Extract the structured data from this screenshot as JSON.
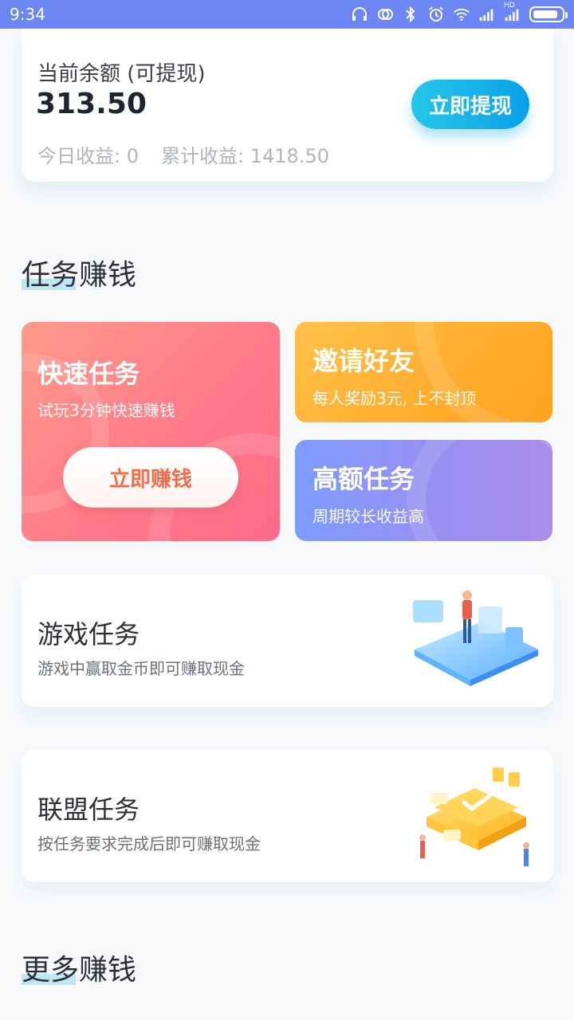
{
  "status_bar": {
    "time": "9:34",
    "hd_label": "HD"
  },
  "balance": {
    "label": "当前余额 (可提现)",
    "value": "313.50",
    "withdraw_button": "立即提现",
    "today_label": "今日收益:",
    "today_value": "0",
    "total_label": "累计收益:",
    "total_value": "1418.50"
  },
  "sections": {
    "task_title": "任务赚钱",
    "more_title": "更多赚钱"
  },
  "cards": {
    "quick": {
      "title": "快速任务",
      "subtitle": "试玩3分钟快速赚钱",
      "button": "立即赚钱"
    },
    "invite": {
      "title": "邀请好友",
      "subtitle": "每人奖励3元, 上不封顶"
    },
    "high": {
      "title": "高额任务",
      "subtitle": "周期较长收益高"
    },
    "game": {
      "title": "游戏任务",
      "subtitle": "游戏中赢取金币即可赚取现金"
    },
    "alliance": {
      "title": "联盟任务",
      "subtitle": "按任务要求完成后即可赚取现金"
    }
  },
  "colors": {
    "status_bar": "#6c86f2",
    "withdraw": "#0aa0e9",
    "quick_card": "#ff7b8a",
    "invite_card": "#ffad2e",
    "high_card": "#9a8ff0"
  }
}
